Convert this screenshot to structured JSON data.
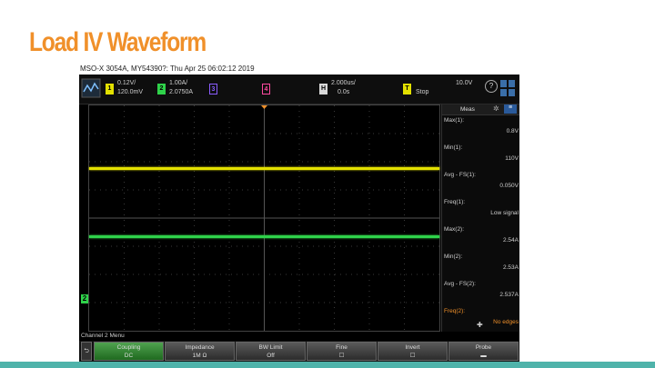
{
  "slide": {
    "title": "Load IV Waveform",
    "title_color": "#f0902a"
  },
  "caption": "MSO-X 3054A, MY54390?: Thu Apr 25 06:02:12 2019",
  "scope": {
    "topbar": {
      "ch1": {
        "num": "1",
        "scale": "0.12V/",
        "offset": "120.0mV",
        "color": "#e3e000"
      },
      "ch2": {
        "num": "2",
        "scale": "1.00A/",
        "offset": "2.0750A",
        "color": "#2fd24a"
      },
      "ch3": {
        "num": "3",
        "color": "#8a5cff"
      },
      "ch4": {
        "num": "4",
        "color": "#ff4aa0"
      },
      "timebase": {
        "num": "H",
        "value": "2.000us/",
        "delay": "0.0s"
      },
      "trigger": {
        "num": "T",
        "mode": "Stop",
        "level": "10.0V"
      },
      "help_icon": "help-icon"
    },
    "meas": {
      "header": "Meas",
      "rows": [
        {
          "label": "Max(1):",
          "value": "0.8V"
        },
        {
          "label": "Min(1):",
          "value": "110V"
        },
        {
          "label": "Avg - FS(1):",
          "value": "0.050V"
        },
        {
          "label": "Freq(1):",
          "value": "Low signal"
        },
        {
          "label": "Max(2):",
          "value": "2.54A"
        },
        {
          "label": "Min(2):",
          "value": "2.53A"
        },
        {
          "label": "Avg - FS(2):",
          "value": "2.537A"
        },
        {
          "label": "Freq(2):",
          "value": "No edges"
        }
      ]
    },
    "menu_label": "Channel 2 Menu",
    "softkeys": [
      {
        "label": "Coupling",
        "value": "DC"
      },
      {
        "label": "Impedance",
        "value": "1M Ω"
      },
      {
        "label": "BW Limit",
        "value": "Off"
      },
      {
        "label": "Fine",
        "value": "☐"
      },
      {
        "label": "Invert",
        "value": "☐"
      },
      {
        "label": "Probe",
        "value": "▬"
      }
    ],
    "markers": {
      "ch1": "1",
      "ch2": "2"
    }
  }
}
